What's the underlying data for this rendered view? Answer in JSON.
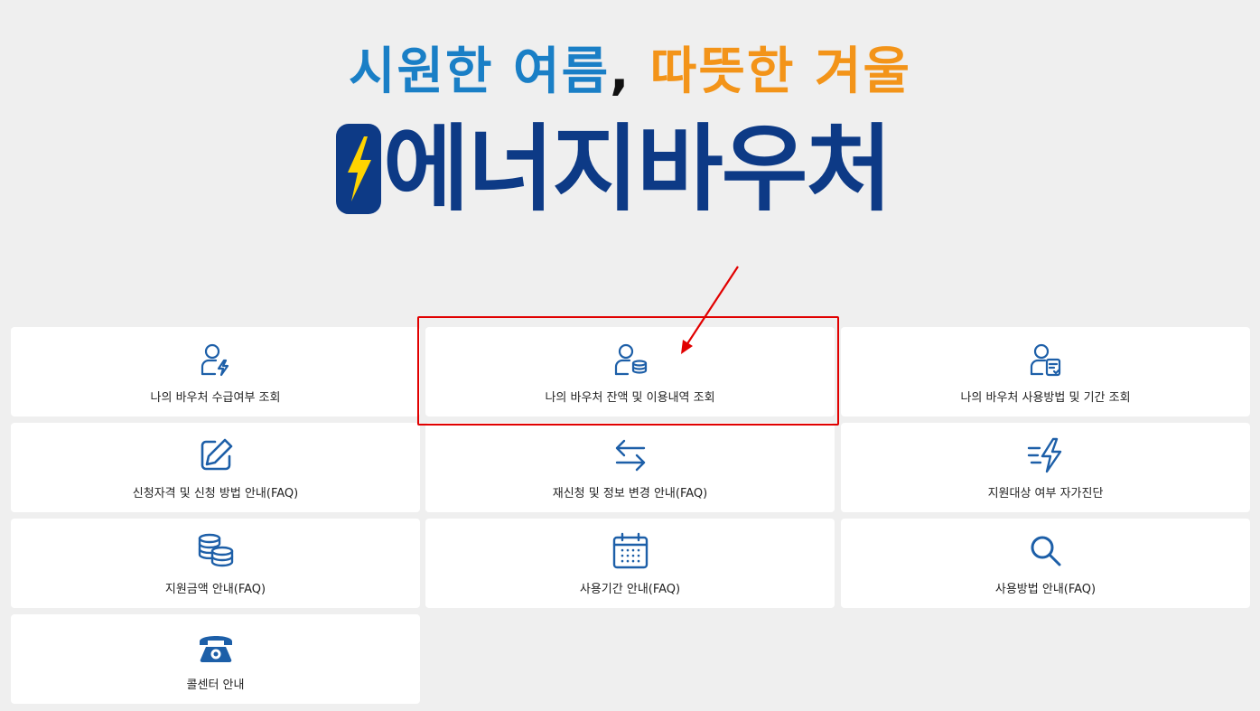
{
  "header": {
    "tagline_cool": "시원한 여름",
    "tagline_comma": ",",
    "tagline_warm": "따뜻한 겨울",
    "brand": "에너지바우처",
    "colors": {
      "cool": "#1a7fc6",
      "warm": "#f39419",
      "brand": "#0d3a86",
      "bolt": "#ffd400",
      "highlight": "#e10000"
    }
  },
  "menu": [
    {
      "label": "나의 바우처 수급여부 조회",
      "icon": "user-bolt-icon"
    },
    {
      "label": "나의 바우처 잔액 및 이용내역 조회",
      "icon": "user-coins-icon",
      "highlighted": true
    },
    {
      "label": "나의 바우처 사용방법 및 기간 조회",
      "icon": "user-document-icon"
    },
    {
      "label": "신청자격 및 신청 방법 안내(FAQ)",
      "icon": "edit-icon"
    },
    {
      "label": "재신청 및 정보 변경 안내(FAQ)",
      "icon": "swap-arrows-icon"
    },
    {
      "label": "지원대상 여부 자가진단",
      "icon": "fast-bolt-icon"
    },
    {
      "label": "지원금액 안내(FAQ)",
      "icon": "coin-stack-icon"
    },
    {
      "label": "사용기간 안내(FAQ)",
      "icon": "calendar-icon"
    },
    {
      "label": "사용방법 안내(FAQ)",
      "icon": "search-icon"
    },
    {
      "label": "콜센터 안내",
      "icon": "phone-icon"
    }
  ]
}
